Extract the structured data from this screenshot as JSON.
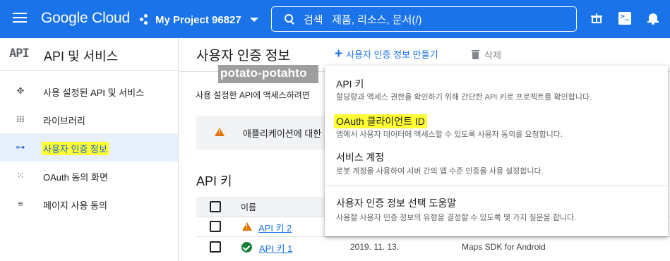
{
  "topbar": {
    "logo": "Google Cloud",
    "project": "My Project 96827",
    "search_placeholder": "검색   제품, 리소스, 문서(/)"
  },
  "sidebar": {
    "logo": "API",
    "title": "API 및 서비스",
    "items": [
      {
        "label": "사용 설정된 API 및 서비스",
        "icon": "diamond-grid-icon"
      },
      {
        "label": "라이브러리",
        "icon": "library-icon"
      },
      {
        "label": "사용자 인증 정보",
        "icon": "key-icon",
        "active": true
      },
      {
        "label": "OAuth 동의 화면",
        "icon": "consent-icon"
      },
      {
        "label": "페이지 사용 동의",
        "icon": "agreement-icon"
      }
    ]
  },
  "main": {
    "title": "사용자 인증 정보",
    "create_label": "사용자 인증 정보 만들기",
    "delete_label": "삭제",
    "watermark": "potato-potahto",
    "description": "사용 설정한 API에 액세스하려면",
    "warning": "애플리케이션에 대한",
    "section_title": "API 키",
    "table": {
      "header_name": "이름",
      "rows": [
        {
          "name": "API 키 2",
          "status": "warning",
          "date": "",
          "restriction": ""
        },
        {
          "name": "API 키 1",
          "status": "ok",
          "date": "2019. 11. 13.",
          "restriction": "Maps SDK for Android"
        }
      ]
    }
  },
  "menu": {
    "items": [
      {
        "title": "API 키",
        "desc": "할당량과 액세스 권한을 확인하기 위해 간단한 API 키로 프로젝트를 확인합니다."
      },
      {
        "title": "OAuth 클라이언트 ID",
        "desc": "앱에서 사용자 데이터에 액세스할 수 있도록 사용자 동의를 요청합니다.",
        "highlighted": true
      },
      {
        "title": "서비스 계정",
        "desc": "로봇 계정을 사용하여 서버 간의 앱 수준 인증을 사용 설정합니다."
      },
      {
        "title": "사용자 인증 정보 선택 도움말",
        "desc": "사용할 사용자 인증 정보의 유형을 결정할 수 있도록 몇 가지 질문을 합니다."
      }
    ]
  },
  "colors": {
    "brand": "#1a73e8",
    "highlight": "#ffff33",
    "warning": "#e37400",
    "success": "#188038"
  }
}
